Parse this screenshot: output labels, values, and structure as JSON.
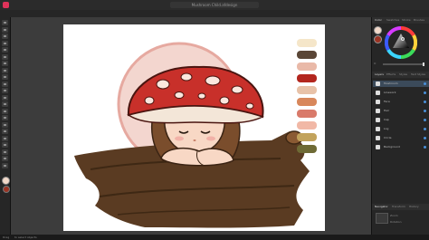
{
  "window": {
    "title": "Mushroom Child.afdesign"
  },
  "context_tabs": [
    "No Selection",
    "Document Setup",
    "Preferences"
  ],
  "tools": [
    "move",
    "node",
    "pen",
    "pencil",
    "brush",
    "fill",
    "gradient",
    "shape",
    "rectangle",
    "ellipse",
    "text",
    "frame-text",
    "crop",
    "eyedropper",
    "zoom",
    "view",
    "transparency",
    "vector-brush",
    "smudge",
    "erase",
    "paint-mixer",
    "place"
  ],
  "palette_colors": [
    "#f5e6c9",
    "#5a4636",
    "#e9b9a8",
    "#b3261e",
    "#e8c2a8",
    "#d8875b",
    "#d97a6a",
    "#f1b8a6",
    "#c2a35c",
    "#6e6a35"
  ],
  "right_panel": {
    "tabs": [
      "Color",
      "Swatches",
      "Stroke",
      "Brushes"
    ],
    "mode_tabs": [
      "Layers",
      "Effects",
      "Styles",
      "Text Styles"
    ],
    "sliders": [
      "H",
      "S",
      "L",
      "O"
    ],
    "layers": [
      {
        "name": "Mushroom"
      },
      {
        "name": "Linework"
      },
      {
        "name": "Face"
      },
      {
        "name": "Hair"
      },
      {
        "name": "Cap"
      },
      {
        "name": "Log"
      },
      {
        "name": "Circle"
      },
      {
        "name": "Background"
      }
    ],
    "nav_tabs": [
      "Navigator",
      "Transform",
      "History"
    ],
    "nav_rows": [
      "Zoom",
      "Rotation"
    ]
  },
  "status": {
    "left": "Drag",
    "right": "to select objects"
  },
  "colors": {
    "accent": "#4a90d9",
    "brand": "#e0335a"
  }
}
